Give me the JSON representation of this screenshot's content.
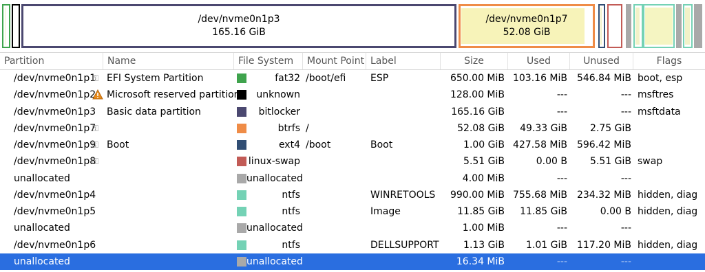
{
  "graph": {
    "p3": {
      "name": "/dev/nvme0n1p3",
      "size": "165.16 GiB"
    },
    "p7": {
      "name": "/dev/nvme0n1p7",
      "size": "52.08 GiB"
    }
  },
  "columns": {
    "partition": "Partition",
    "name": "Name",
    "filesystem": "File System",
    "mountpoint": "Mount Point",
    "label": "Label",
    "size": "Size",
    "used": "Used",
    "unused": "Unused",
    "flags": "Flags"
  },
  "rows": [
    {
      "partition": "/dev/nvme0n1p1",
      "name": "EFI System Partition",
      "fs": "fat32",
      "color": "#3fa34d",
      "mount": "/boot/efi",
      "label": "ESP",
      "size": "650.00 MiB",
      "used": "103.16 MiB",
      "unused": "546.84 MiB",
      "flags": "boot, esp"
    },
    {
      "partition": "/dev/nvme0n1p2",
      "name": "Microsoft reserved partition",
      "fs": "unknown",
      "color": "#000000",
      "mount": "",
      "label": "",
      "size": "128.00 MiB",
      "used": "---",
      "unused": "---",
      "flags": "msftres"
    },
    {
      "partition": "/dev/nvme0n1p3",
      "name": "Basic data partition",
      "fs": "bitlocker",
      "color": "#4b4870",
      "mount": "",
      "label": "",
      "size": "165.16 GiB",
      "used": "---",
      "unused": "---",
      "flags": "msftdata"
    },
    {
      "partition": "/dev/nvme0n1p7",
      "name": "",
      "fs": "btrfs",
      "color": "#ef8c47",
      "mount": "/",
      "label": "",
      "size": "52.08 GiB",
      "used": "49.33 GiB",
      "unused": "2.75 GiB",
      "flags": ""
    },
    {
      "partition": "/dev/nvme0n1p9",
      "name": "Boot",
      "fs": "ext4",
      "color": "#314e74",
      "mount": "/boot",
      "label": "Boot",
      "size": "1.00 GiB",
      "used": "427.58 MiB",
      "unused": "596.42 MiB",
      "flags": ""
    },
    {
      "partition": "/dev/nvme0n1p8",
      "name": "",
      "fs": "linux-swap",
      "color": "#c25b56",
      "mount": "",
      "label": "",
      "size": "5.51 GiB",
      "used": "0.00 B",
      "unused": "5.51 GiB",
      "flags": "swap"
    },
    {
      "partition": "unallocated",
      "name": "",
      "fs": "unallocated",
      "color": "#a9a9a9",
      "mount": "",
      "label": "",
      "size": "4.00 MiB",
      "used": "---",
      "unused": "---",
      "flags": ""
    },
    {
      "partition": "/dev/nvme0n1p4",
      "name": "",
      "fs": "ntfs",
      "color": "#74d2b5",
      "mount": "",
      "label": "WINRETOOLS",
      "size": "990.00 MiB",
      "used": "755.68 MiB",
      "unused": "234.32 MiB",
      "flags": "hidden, diag"
    },
    {
      "partition": "/dev/nvme0n1p5",
      "name": "",
      "fs": "ntfs",
      "color": "#74d2b5",
      "mount": "",
      "label": "Image",
      "size": "11.85 GiB",
      "used": "11.85 GiB",
      "unused": "0.00 B",
      "flags": "hidden, diag"
    },
    {
      "partition": "unallocated",
      "name": "",
      "fs": "unallocated",
      "color": "#a9a9a9",
      "mount": "",
      "label": "",
      "size": "1.00 MiB",
      "used": "---",
      "unused": "---",
      "flags": ""
    },
    {
      "partition": "/dev/nvme0n1p6",
      "name": "",
      "fs": "ntfs",
      "color": "#74d2b5",
      "mount": "",
      "label": "DELLSUPPORT",
      "size": "1.13 GiB",
      "used": "1.01 GiB",
      "unused": "117.20 MiB",
      "flags": "hidden, diag"
    },
    {
      "partition": "unallocated",
      "name": "",
      "fs": "unallocated",
      "color": "#a9a9a9",
      "mount": "",
      "label": "",
      "size": "16.34 MiB",
      "used": "---",
      "unused": "---",
      "flags": "",
      "selected": true
    }
  ]
}
